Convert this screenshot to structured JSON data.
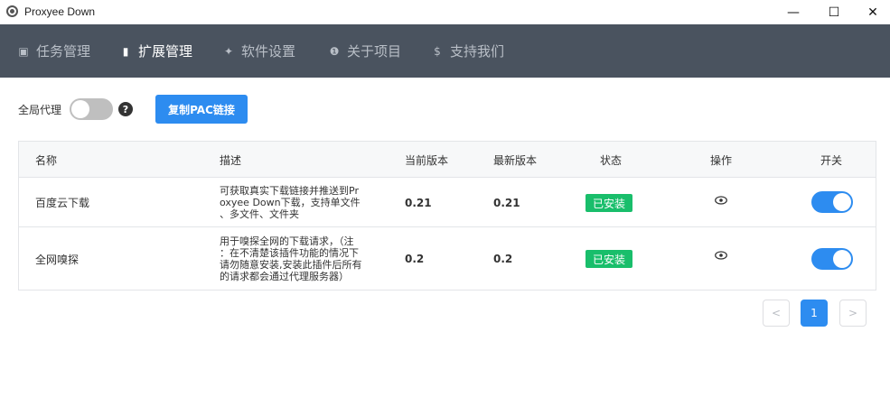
{
  "window": {
    "title": "Proxyee Down",
    "controls": {
      "minimize": "—",
      "maximize": "☐",
      "close": "✕"
    }
  },
  "nav": {
    "items": [
      {
        "icon": "▣",
        "label": "任务管理"
      },
      {
        "icon": "▮",
        "label": "扩展管理"
      },
      {
        "icon": "✦",
        "label": "软件设置"
      },
      {
        "icon": "❶",
        "label": "关于项目"
      },
      {
        "icon": "$",
        "label": "支持我们"
      }
    ],
    "active_index": 1
  },
  "toolbar": {
    "global_proxy_label": "全局代理",
    "global_proxy_on": false,
    "help_icon": "?",
    "copy_pac_label": "复制PAC链接"
  },
  "table": {
    "headers": [
      "名称",
      "描述",
      "当前版本",
      "最新版本",
      "状态",
      "操作",
      "开关"
    ],
    "rows": [
      {
        "name": "百度云下载",
        "desc_lines": [
          "可获取真实下载链接并推送到Pr",
          "oxyee Down下载，支持单文件",
          "、多文件、文件夹"
        ],
        "current_version": "0.21",
        "latest_version": "0.21",
        "status": "已安装",
        "enabled": true
      },
      {
        "name": "全网嗅探",
        "desc_lines": [
          "用于嗅探全网的下载请求，（注",
          "：在不清楚该插件功能的情况下",
          "请勿随意安装,安装此插件后所有",
          "的请求都会通过代理服务器）"
        ],
        "current_version": "0.2",
        "latest_version": "0.2",
        "status": "已安装",
        "enabled": true
      }
    ]
  },
  "pagination": {
    "prev": "<",
    "current": "1",
    "next": ">"
  },
  "colors": {
    "nav_bg": "#4a535f",
    "primary": "#2d8cf0",
    "success": "#19be6b"
  }
}
